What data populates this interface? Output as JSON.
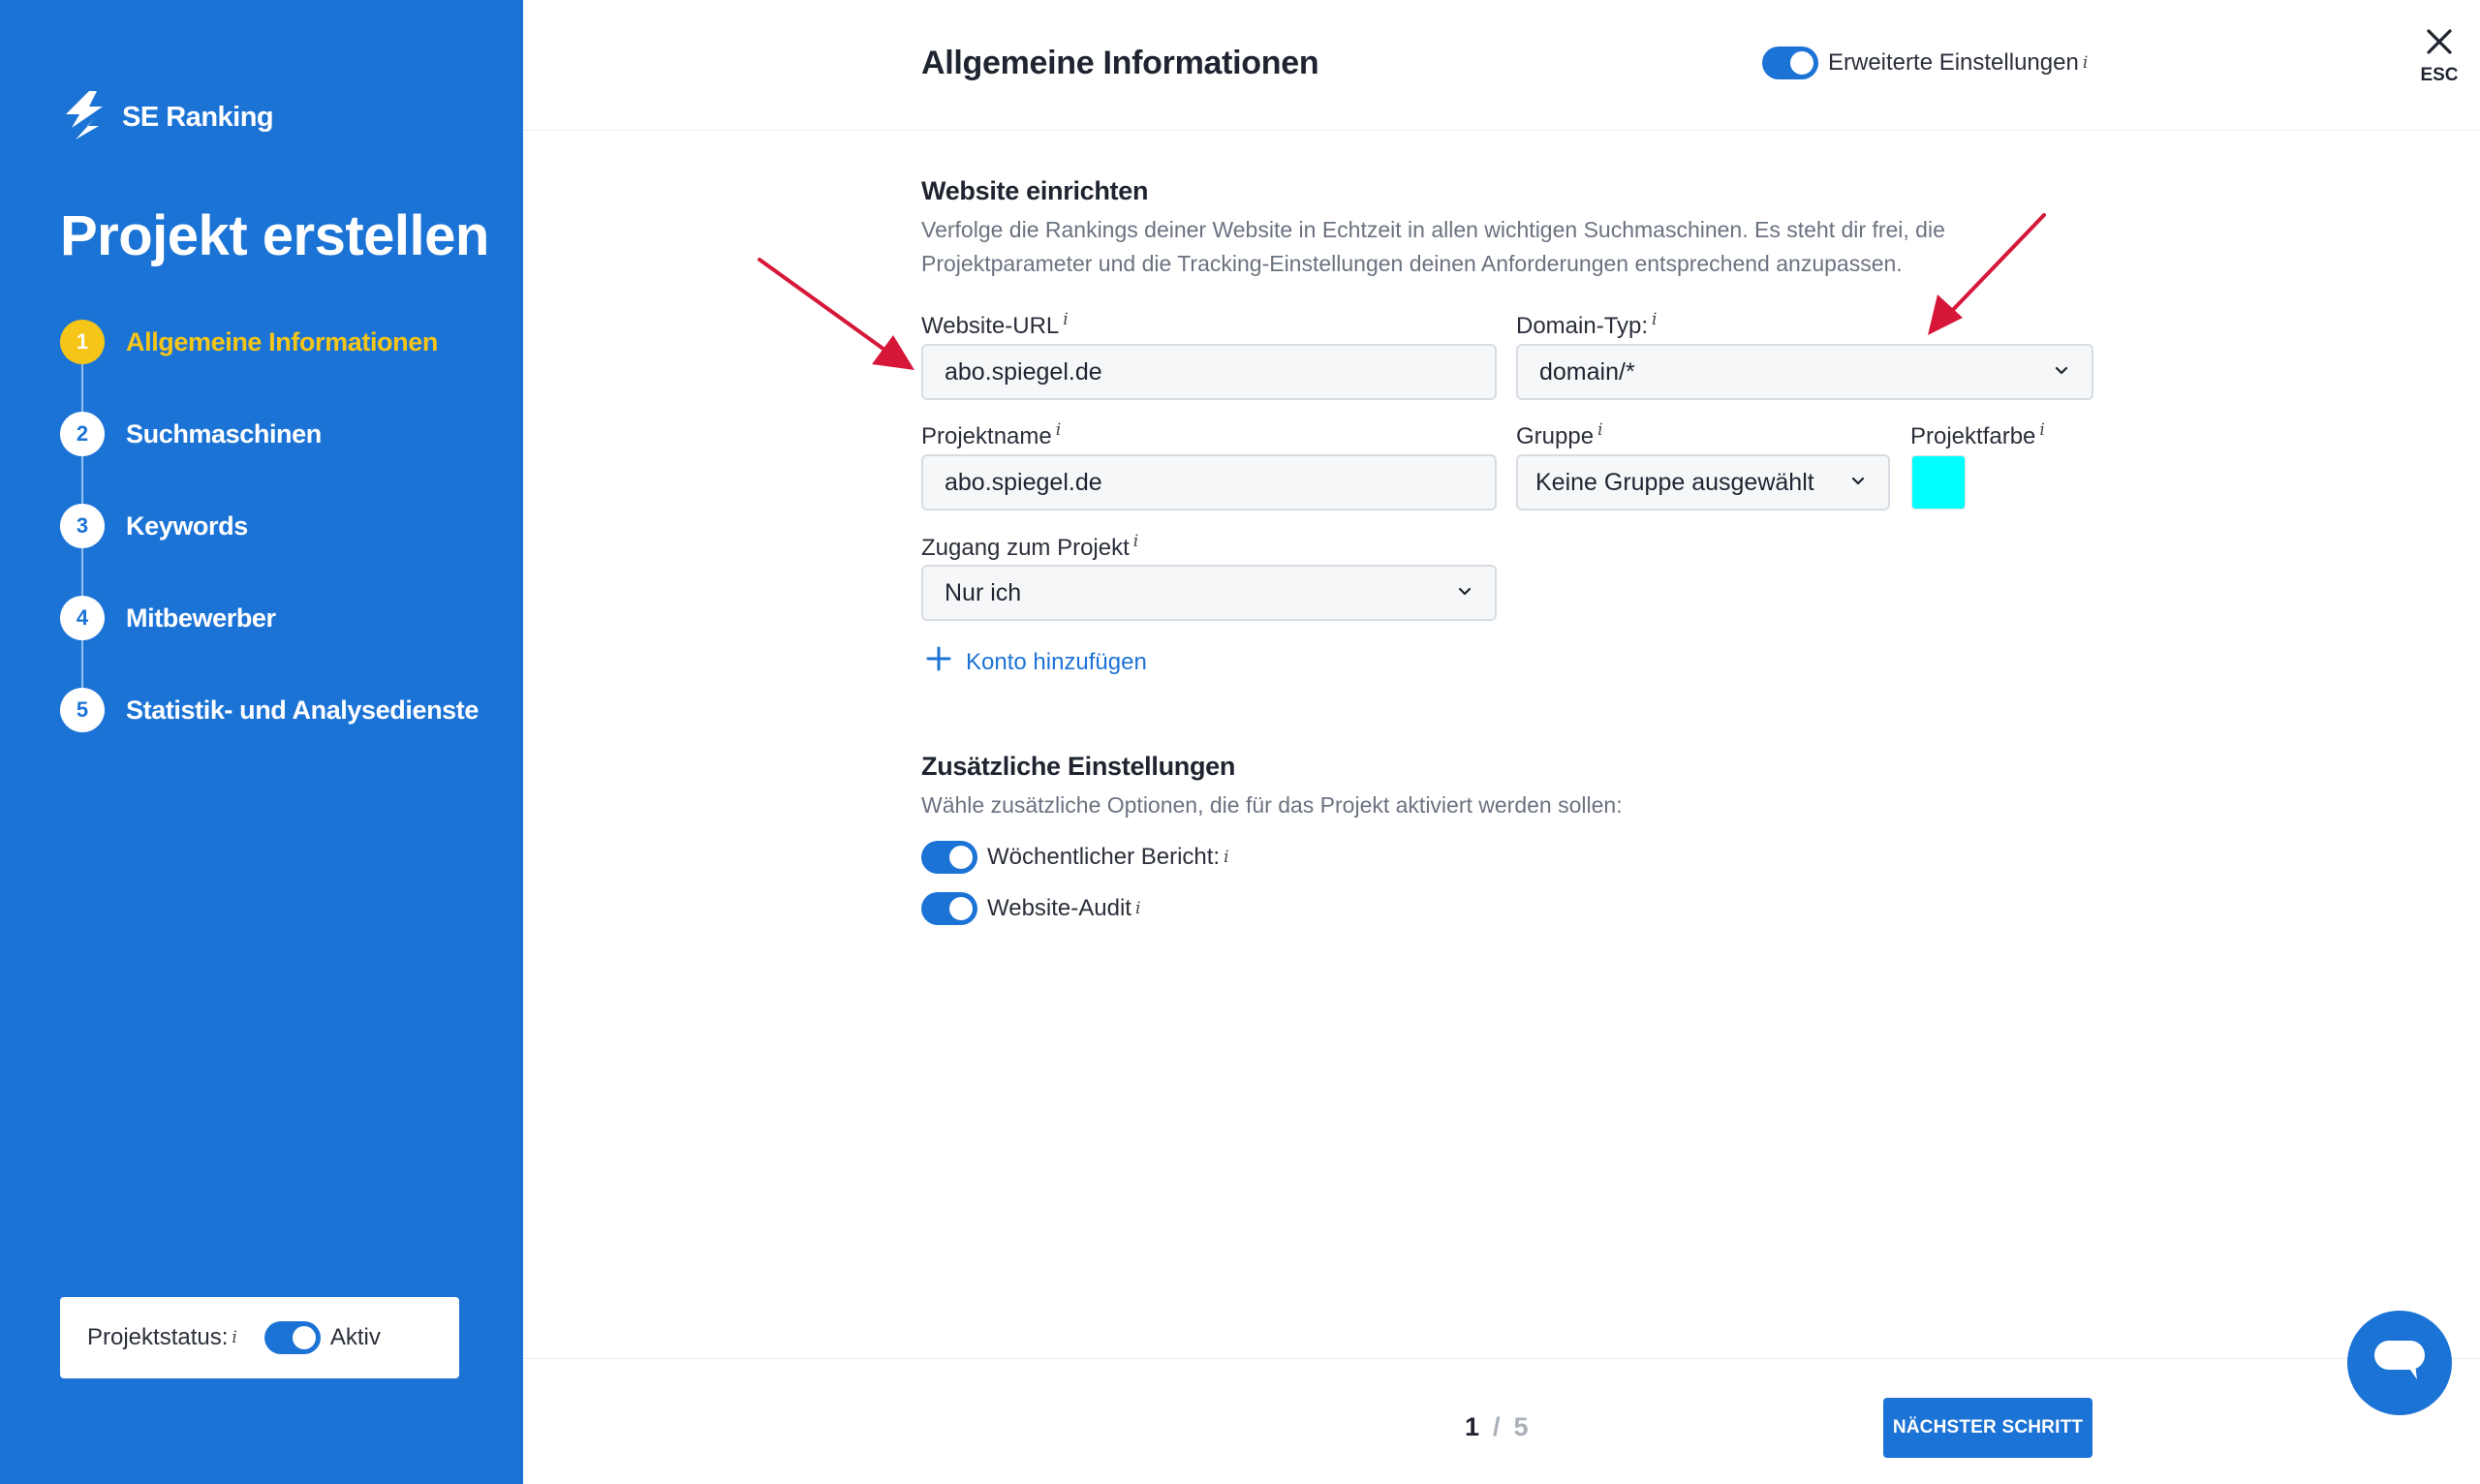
{
  "colors": {
    "brand": "#1c73d6",
    "active_step": "#f5c518",
    "project_color": "#00ffff",
    "annotation_arrow": "#d6173a"
  },
  "sidebar": {
    "logo_text": "SE Ranking",
    "title": "Projekt erstellen",
    "steps": [
      {
        "number": "1",
        "label": "Allgemeine Informationen",
        "active": true
      },
      {
        "number": "2",
        "label": "Suchmaschinen",
        "active": false
      },
      {
        "number": "3",
        "label": "Keywords",
        "active": false
      },
      {
        "number": "4",
        "label": "Mitbewerber",
        "active": false
      },
      {
        "number": "5",
        "label": "Statistik- und Analysedienste",
        "active": false
      }
    ],
    "status_label": "Projektstatus:",
    "status_value": "Aktiv",
    "status_on": true
  },
  "header": {
    "title": "Allgemeine Informationen",
    "advanced_label": "Erweiterte Einstellungen",
    "advanced_on": true,
    "close_label": "ESC",
    "info_glyph": "i"
  },
  "website_section": {
    "title": "Website einrichten",
    "desc_line1": "Verfolge die Rankings deiner Website in Echtzeit in allen wichtigen Suchmaschinen. Es steht dir frei, die",
    "desc_line2": "Projektparameter und die Tracking-Einstellungen deinen Anforderungen entsprechend anzupassen."
  },
  "form": {
    "url_label": "Website-URL",
    "url_value": "abo.spiegel.de",
    "domain_type_label": "Domain-Typ:",
    "domain_type_value": "domain/*",
    "project_name_label": "Projektname",
    "project_name_value": "abo.spiegel.de",
    "group_label": "Gruppe",
    "group_value": "Keine Gruppe ausgewählt",
    "color_label": "Projektfarbe",
    "access_label": "Zugang zum Projekt",
    "access_value": "Nur ich",
    "add_account_label": "Konto hinzufügen"
  },
  "extra_section": {
    "title": "Zusätzliche Einstellungen",
    "desc": "Wähle zusätzliche Optionen, die für das Projekt aktiviert werden sollen:",
    "options": [
      {
        "label": "Wöchentlicher Bericht:",
        "on": true
      },
      {
        "label": "Website-Audit",
        "on": true
      }
    ]
  },
  "footer": {
    "current_page": "1",
    "separator": "/",
    "total_pages": "5",
    "next_label": "NÄCHSTER SCHRITT"
  }
}
